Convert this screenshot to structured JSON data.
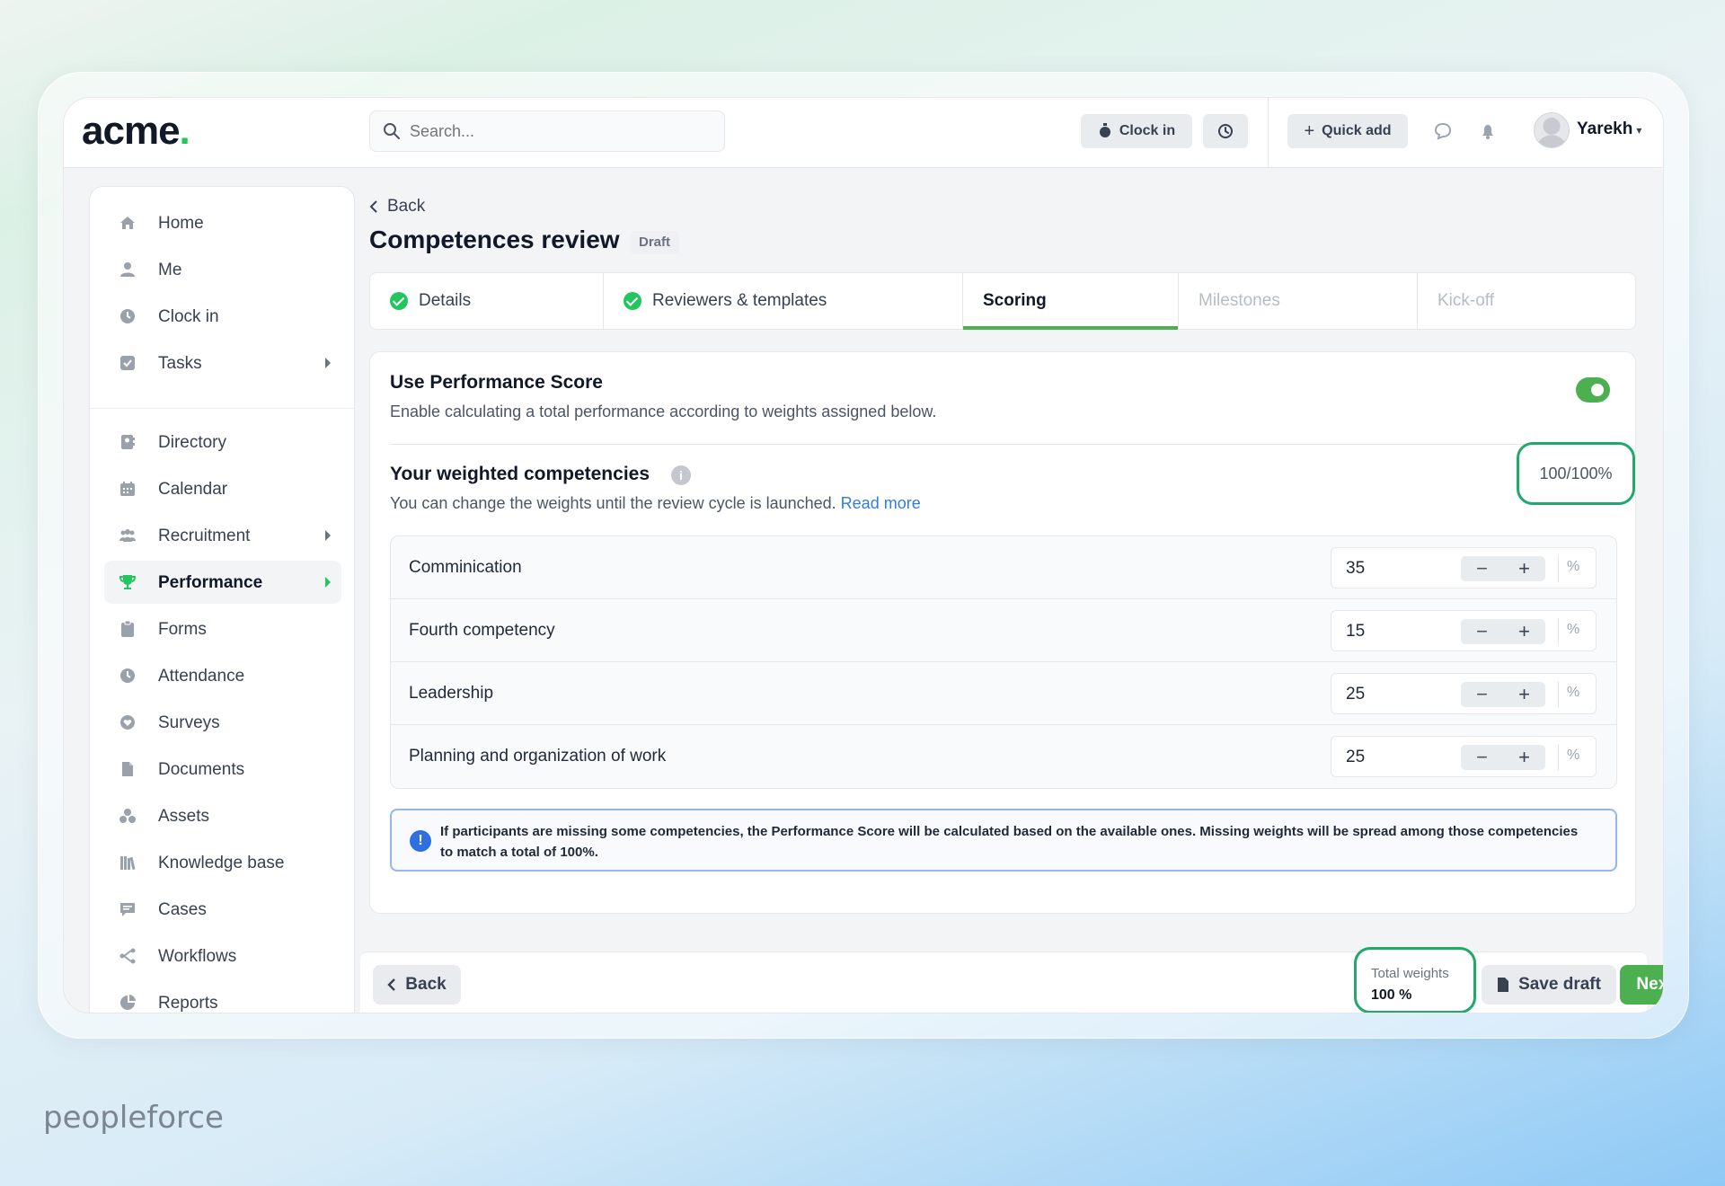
{
  "app": {
    "logo": "acme",
    "logo_dot": "."
  },
  "header": {
    "search_placeholder": "Search...",
    "clock_in_label": "Clock in",
    "quick_add_label": "Quick add",
    "user_name": "Yarekh"
  },
  "sidebar": {
    "items": [
      {
        "label": "Home",
        "icon": "home-icon"
      },
      {
        "label": "Me",
        "icon": "user-icon"
      },
      {
        "label": "Clock in",
        "icon": "clock-icon"
      },
      {
        "label": "Tasks",
        "icon": "checkbox-icon",
        "has_submenu": true
      },
      {
        "label": "Directory",
        "icon": "directory-icon"
      },
      {
        "label": "Calendar",
        "icon": "calendar-icon"
      },
      {
        "label": "Recruitment",
        "icon": "people-icon",
        "has_submenu": true
      },
      {
        "label": "Performance",
        "icon": "trophy-icon",
        "has_submenu": true,
        "active": true
      },
      {
        "label": "Forms",
        "icon": "clipboard-icon"
      },
      {
        "label": "Attendance",
        "icon": "clock-icon"
      },
      {
        "label": "Surveys",
        "icon": "heart-icon"
      },
      {
        "label": "Documents",
        "icon": "document-icon"
      },
      {
        "label": "Assets",
        "icon": "assets-icon"
      },
      {
        "label": "Knowledge base",
        "icon": "books-icon"
      },
      {
        "label": "Cases",
        "icon": "chat-icon"
      },
      {
        "label": "Workflows",
        "icon": "workflow-icon"
      },
      {
        "label": "Reports",
        "icon": "pie-icon"
      }
    ]
  },
  "page": {
    "back_label": "Back",
    "title": "Competences review",
    "badge": "Draft",
    "tabs": [
      {
        "label": "Details",
        "state": "done"
      },
      {
        "label": "Reviewers & templates",
        "state": "done"
      },
      {
        "label": "Scoring",
        "state": "active"
      },
      {
        "label": "Milestones",
        "state": "disabled"
      },
      {
        "label": "Kick-off",
        "state": "disabled"
      }
    ]
  },
  "scoring": {
    "use_score_title": "Use Performance Score",
    "use_score_desc": "Enable calculating a total performance according to weights assigned below.",
    "use_score_enabled": true,
    "weighted_title": "Your weighted competencies",
    "weighted_desc": "You can change the weights until the review cycle is launched.",
    "read_more": "Read more",
    "weight_total": "100/100%",
    "competencies": [
      {
        "name": "Comminication",
        "weight": "35"
      },
      {
        "name": "Fourth competency",
        "weight": "15"
      },
      {
        "name": "Leadership",
        "weight": "25"
      },
      {
        "name": "Planning and organization of work",
        "weight": "25"
      }
    ],
    "percent_sign": "%",
    "notice": "If participants are missing some competencies, the Performance Score will be calculated based on the available ones. Missing weights will be spread among those competencies to match a total of 100%."
  },
  "footer": {
    "back_label": "Back",
    "total_label": "Total weights",
    "total_value": "100 %",
    "save_label": "Save draft",
    "next_label": "Next"
  },
  "brand": "peopleforce",
  "colors": {
    "accent": "#4caf50",
    "check": "#22c55e",
    "highlight": "#21a86a",
    "link": "#2f7de1",
    "info": "#2f6fe0"
  }
}
